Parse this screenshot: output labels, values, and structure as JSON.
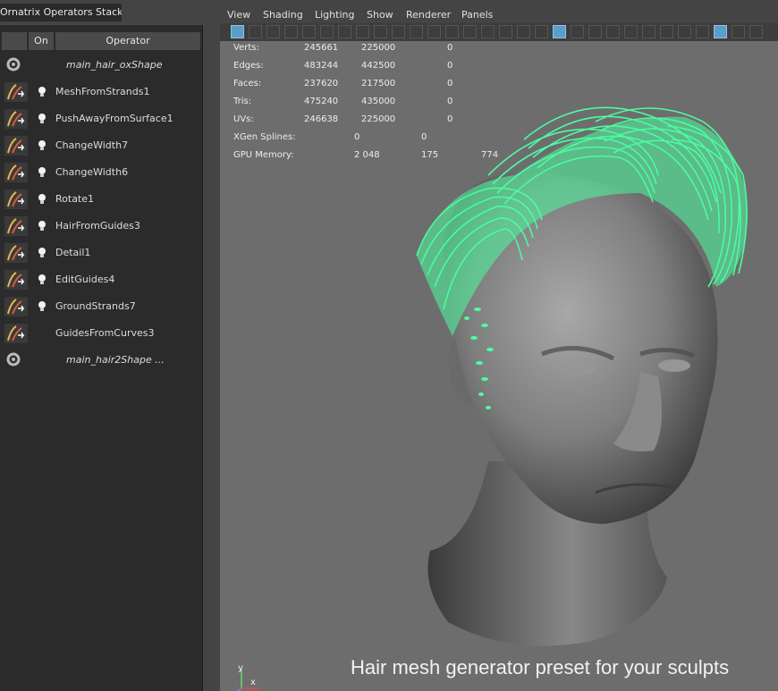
{
  "panel": {
    "title": "Ornatrix Operators Stack",
    "col_on": "On",
    "col_operator": "Operator",
    "rows": [
      {
        "label": "main_hair_oxShape",
        "italic": true,
        "icon": "gear-icon"
      },
      {
        "label": "MeshFromStrands1",
        "icon": "mesh-from-strands-icon",
        "bulb": true
      },
      {
        "label": "PushAwayFromSurface1",
        "icon": "push-away-icon",
        "bulb": true
      },
      {
        "label": "ChangeWidth7",
        "icon": "change-width-icon",
        "bulb": true
      },
      {
        "label": "ChangeWidth6",
        "icon": "change-width-icon",
        "bulb": true
      },
      {
        "label": "Rotate1",
        "icon": "rotate-icon",
        "bulb": true
      },
      {
        "label": "HairFromGuides3",
        "icon": "hair-from-guides-icon",
        "bulb": true
      },
      {
        "label": "Detail1",
        "icon": "detail-icon",
        "bulb": true
      },
      {
        "label": "EditGuides4",
        "icon": "edit-guides-icon",
        "bulb": true
      },
      {
        "label": "GroundStrands7",
        "icon": "ground-strands-icon",
        "bulb": true
      },
      {
        "label": "GuidesFromCurves3",
        "icon": "guides-from-curves-icon",
        "bulb": false
      },
      {
        "label": "main_hair2Shape ...",
        "italic": true,
        "icon": "gear-icon"
      }
    ]
  },
  "menu": [
    "View",
    "Shading",
    "Lighting",
    "Show",
    "Renderer",
    "Panels"
  ],
  "hud": [
    {
      "label": "Verts:",
      "a": "245661",
      "b": "225000",
      "c": "0"
    },
    {
      "label": "Edges:",
      "a": "483244",
      "b": "442500",
      "c": "0"
    },
    {
      "label": "Faces:",
      "a": "237620",
      "b": "217500",
      "c": "0"
    },
    {
      "label": "Tris:",
      "a": "475240",
      "b": "435000",
      "c": "0"
    },
    {
      "label": "UVs:",
      "a": "246638",
      "b": "225000",
      "c": "0"
    },
    {
      "label": "XGen Splines:",
      "a": "0",
      "b": "0",
      "c": ""
    },
    {
      "label": "GPU Memory:",
      "a": "2 048",
      "b": "175",
      "c": "774"
    }
  ],
  "caption": "Hair mesh generator preset for your sculpts",
  "axis": {
    "y": "y",
    "x": "x"
  },
  "colors": {
    "hair": "#4dfca0",
    "viewport": "#6d6d6d",
    "panel": "#2b2b2b",
    "header": "#4a4a4a",
    "toolbar_active": "#5d9ec8"
  }
}
